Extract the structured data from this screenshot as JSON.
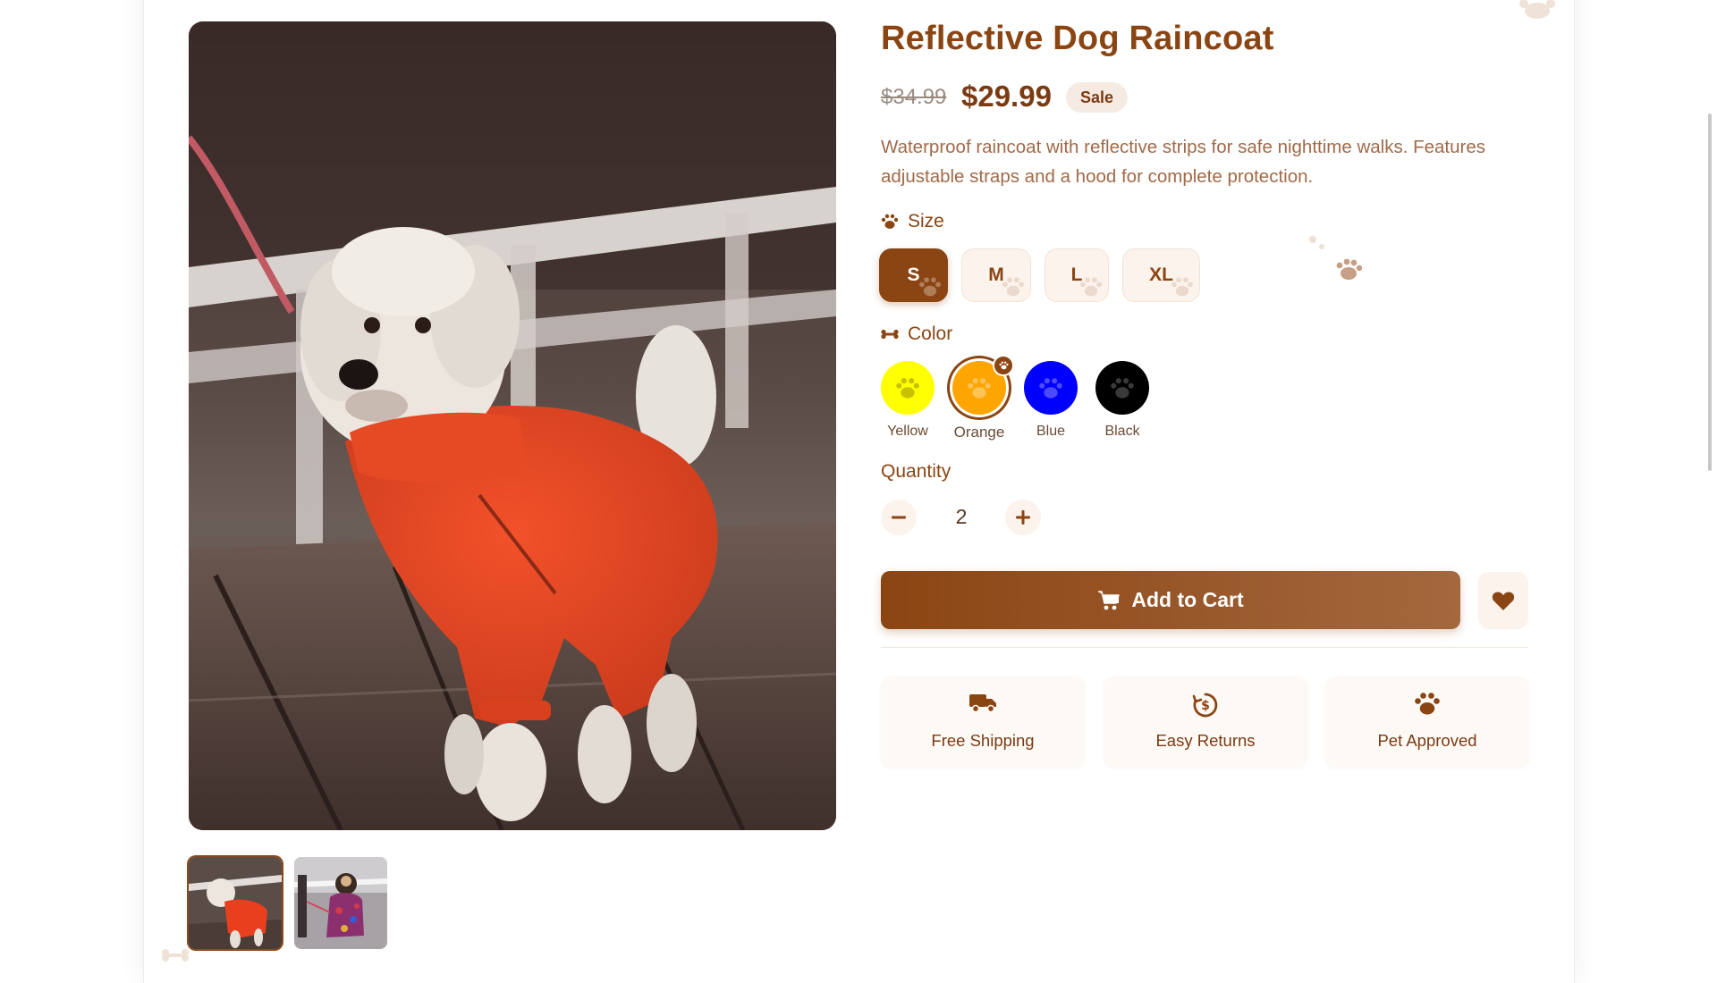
{
  "product": {
    "title": "Reflective Dog Raincoat",
    "old_price": "$34.99",
    "price": "$29.99",
    "badge": "Sale",
    "description": "Waterproof raincoat with reflective strips for safe nighttime walks. Features adjustable straps and a hood for complete protection."
  },
  "size": {
    "label": "Size",
    "options": [
      "S",
      "M",
      "L",
      "XL"
    ],
    "selected": "S"
  },
  "color": {
    "label": "Color",
    "options": [
      {
        "name": "Yellow",
        "hex": "#ffff00"
      },
      {
        "name": "Orange",
        "hex": "#ffa500"
      },
      {
        "name": "Blue",
        "hex": "#0000ff"
      },
      {
        "name": "Black",
        "hex": "#000000"
      }
    ],
    "selected": "Orange"
  },
  "quantity": {
    "label": "Quantity",
    "value": "2"
  },
  "actions": {
    "add_to_cart": "Add to Cart",
    "cart_icon": "cart-icon",
    "wishlist_icon": "heart-icon"
  },
  "features": [
    {
      "label": "Free Shipping",
      "icon": "truck-icon"
    },
    {
      "label": "Easy Returns",
      "icon": "dollar-return-icon"
    },
    {
      "label": "Pet Approved",
      "icon": "paw-icon"
    }
  ],
  "gallery": {
    "thumbnails": [
      "raincoat-front",
      "raincoat-alt"
    ],
    "active": 0
  },
  "theme": {
    "accent": "#8b4513",
    "accent_light": "#fbf3ec",
    "text_muted": "#a06a48"
  }
}
